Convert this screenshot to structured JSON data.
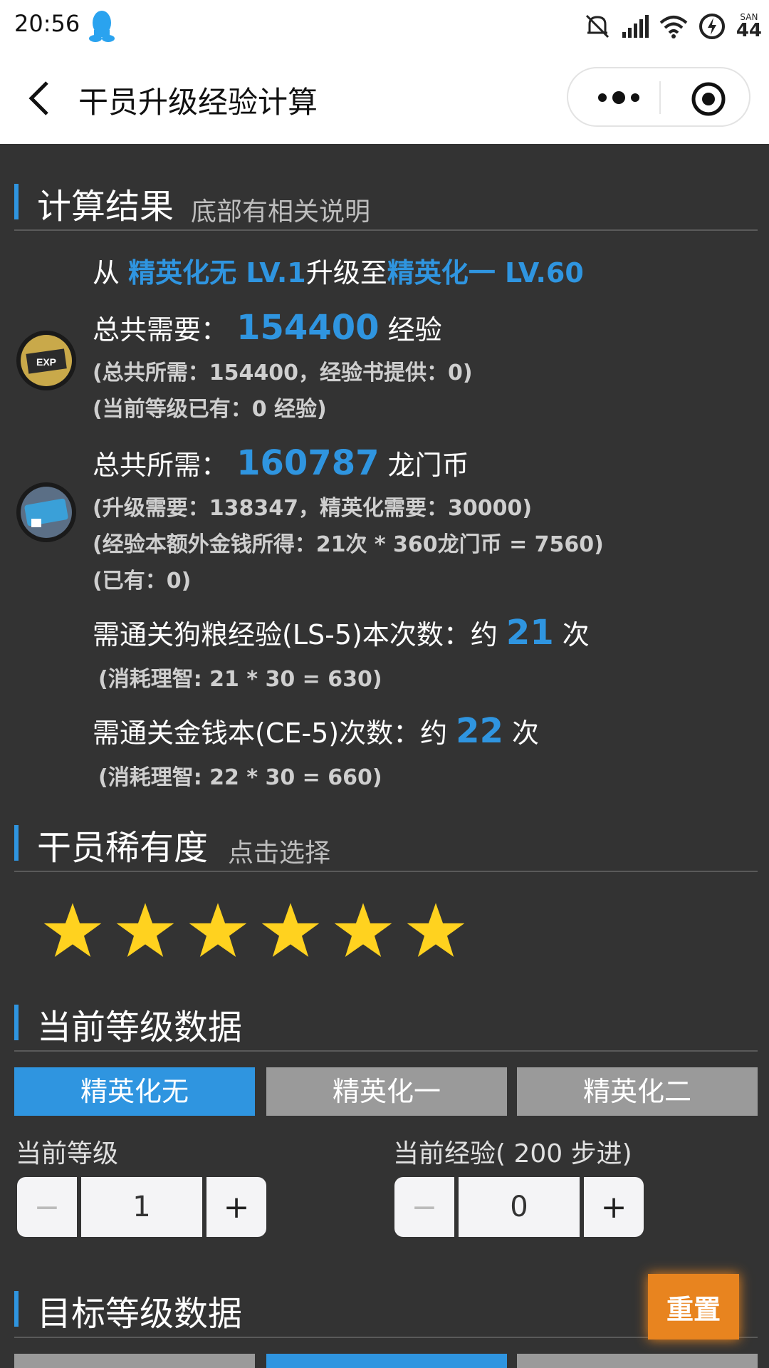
{
  "status_bar": {
    "time": "20:56",
    "battery": "44",
    "san_label": "SAN"
  },
  "title_bar": {
    "title": "干员升级经验计算"
  },
  "result_section": {
    "heading": "计算结果",
    "sub": "底部有相关说明",
    "from_prefix": "从 ",
    "from_stage": "精英化无 LV.1",
    "upgrade_to": "升级至",
    "to_stage": "精英化一 LV.60",
    "exp_label": "总共需要：",
    "exp_value": "154400",
    "exp_unit": "经验",
    "exp_detail_1": "(总共所需：154400，经验书提供：0)",
    "exp_detail_2": "(当前等级已有：0 经验)",
    "coin_label": "总共所需：",
    "coin_value": "160787",
    "coin_unit": "龙门币",
    "coin_detail_1": "(升级需要：138347，精英化需要：30000)",
    "coin_detail_2": "(经验本额外金钱所得：21次 * 360龙门币 = 7560)",
    "coin_detail_3": "(已有：0)",
    "ls_label": "需通关狗粮经验(LS-5)本次数：约 ",
    "ls_value": "21",
    "ls_unit": " 次",
    "ls_detail": "(消耗理智: 21 * 30 = 630)",
    "ce_label": "需通关金钱本(CE-5)次数：约 ",
    "ce_value": "22",
    "ce_unit": " 次",
    "ce_detail": "(消耗理智: 22 * 30 = 660)"
  },
  "rarity_section": {
    "heading": "干员稀有度",
    "sub": "点击选择",
    "stars_selected": 6,
    "stars_total": 6
  },
  "current_section": {
    "heading": "当前等级数据",
    "tabs": [
      "精英化无",
      "精英化一",
      "精英化二"
    ],
    "active_tab": 0,
    "level_label": "当前等级",
    "level_value": "1",
    "exp_label": "当前经验( 200 步进)",
    "exp_value": "0",
    "minus": "−",
    "plus": "+"
  },
  "target_section": {
    "heading": "目标等级数据",
    "active_tab": 1
  },
  "reset_button": "重置",
  "colors": {
    "accent": "#2f95e0",
    "background": "#333333",
    "reset": "#e8841f",
    "star": "#ffd21f"
  }
}
